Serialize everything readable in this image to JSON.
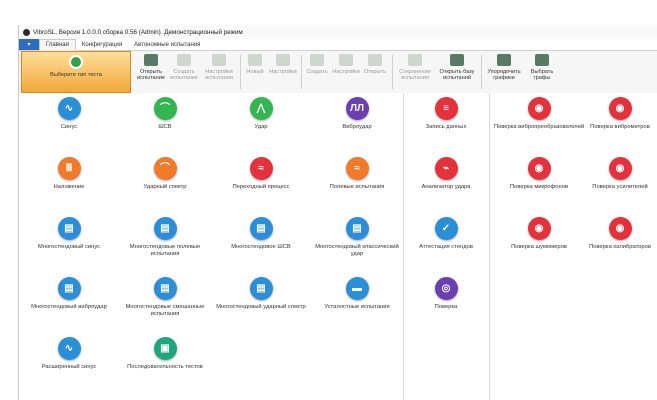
{
  "window": {
    "title": "VibroSL, Версия 1.0.0.0 сборка 0.56 (Admin). Демонстрационный режим"
  },
  "menubar": {
    "file_label": "▾",
    "tabs": [
      "Главная",
      "Конфигурация",
      "Автономные испытания"
    ]
  },
  "ribbon": {
    "select_test": "Выберите тип теста",
    "buttons": [
      "Открыть испытание",
      "Создать испытание",
      "Настройки испытания",
      "Новый",
      "Настройки",
      "Создать",
      "Настройки",
      "Открыть",
      "Сохранение испытания",
      "Открыть базу испытаний",
      "Упорядочить графики",
      "Выбрать графы"
    ]
  },
  "tiles": {
    "sinus": "Синус",
    "scsv": "ШСВ",
    "udar": "Удар",
    "vibroudar": "Виброудар",
    "nalozhenie": "Наложение",
    "udarny_spektr": "Ударный спектр",
    "perehodny": "Переходный процесс",
    "polevye": "Полевые испытания",
    "ms_sinus": "Многостендовый синус",
    "ms_polevye": "Многостендовые полевые испытания",
    "ms_shsv": "Многостендовое ШСВ",
    "ms_klassich": "Многостендовый классический удар",
    "ms_vibroudar": "Многостендовый виброудар",
    "ms_smeshannye": "Многостендовые смешанные испытания",
    "ms_udarny": "Многостендовый ударный спектр",
    "ustalostnye": "Усталостные испытания",
    "rasshirenny": "Расширенный синус",
    "posledovatelnost": "Последовательность тестов",
    "zapis": "Запись данных",
    "analizator": "Анализатор удара",
    "attestacia": "Аттестация стендов",
    "poverka": "Поверка",
    "p_vibropreobr": "Поверка вибропреобразователей",
    "p_vibrometrov": "Поверка виброметров",
    "p_mikrofonov": "Поверка микрофонов",
    "p_usiliteley": "Поверка усилителей",
    "p_shumomerov": "Поверка шумомеров",
    "p_kalibratorov": "Поверка калибраторов"
  },
  "icons": {
    "sinus": "sine-wave",
    "scsv": "random-vibration",
    "udar": "shock-pulse",
    "vibroudar": "repeated-shock",
    "nalozhenie": "bars",
    "udarny_spektr": "curve",
    "perehodny": "transient",
    "polevye": "field-signal",
    "multi": "multi-shaker",
    "ustalostnye": "fatigue",
    "rasshirenny": "sine-extended",
    "posledovatelnost": "sequence",
    "zapis": "data-record",
    "analizator": "heartbeat",
    "attestacia": "checklist",
    "poverka": "target",
    "calibration": "calibration"
  },
  "colors": {
    "blue": "#2a8fd6",
    "green": "#34b552",
    "orange": "#f07a2a",
    "red": "#e3323b",
    "purple": "#6a3fb0",
    "teal": "#1fa67e",
    "accent": "#f2a83a"
  }
}
